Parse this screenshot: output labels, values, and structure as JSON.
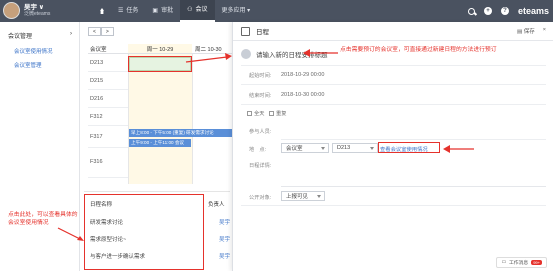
{
  "topbar": {
    "username": "吴宇 ∨",
    "subtitle": "泛微eteams",
    "nav": [
      {
        "label": "任务",
        "icon": "list-icon"
      },
      {
        "label": "审批",
        "icon": "approve-icon"
      },
      {
        "label": "会议",
        "icon": "meeting-icon"
      },
      {
        "label": "更多应用 ▾",
        "icon": ""
      }
    ],
    "logo": "eteams",
    "add": "+",
    "help": "?"
  },
  "sidebar": {
    "group": "会议管理",
    "group_arrow": "›",
    "items": [
      "会议室使用情况",
      "会议室管理"
    ]
  },
  "calendar": {
    "prev": "<",
    "next": ">",
    "header_room": "会议室",
    "header_mon": "周一 10-29",
    "header_tue": "周二 10-30",
    "rooms": [
      "D213",
      "D215",
      "D216",
      "F312",
      "F317",
      "F316"
    ],
    "events": [
      "早上8:00 - 下午5:00 (重复) 研发需求讨论",
      "上午9:00 - 上午11:00 会议"
    ]
  },
  "list": {
    "col_name": "日程名称",
    "col_owner": "负责人",
    "rows": [
      {
        "name": "研发需求讨论",
        "owner": "吴宇"
      },
      {
        "name": "需求原型讨论~",
        "owner": "吴宇"
      },
      {
        "name": "与客户进一步确认需求",
        "owner": "吴宇"
      }
    ]
  },
  "annotations": {
    "left_note": "点击此处，可以查看具体的会议室使用情况",
    "right_note": "点击需要预订的会议室，可直接通过新建日程的方法进行预订"
  },
  "panel": {
    "title": "日程",
    "save": "保存",
    "close": "×",
    "schedule_title_placeholder": "请输入新的日程安排标题",
    "start_label": "起始时间:",
    "start_value": "2018-10-29 00:00",
    "end_label": "结束时间:",
    "end_value": "2018-10-30 00:00",
    "allday": "全天",
    "repeat": "重复",
    "participants_label": "参与人员:",
    "location_label": "地　点:",
    "location_type": "会议室",
    "location_room": "D213",
    "location_link": "查看会议室使用情况",
    "desc_label": "日程详情:",
    "visibility_label": "公开对象:",
    "visibility_value": "上报可见",
    "workflow": "工作消息",
    "workflow_count": "99+"
  },
  "colors": {
    "topbar": "#4a5260",
    "accent_blue": "#3b73c8",
    "annotation_red": "#e5322c",
    "event_blue": "#5a8fd8"
  }
}
